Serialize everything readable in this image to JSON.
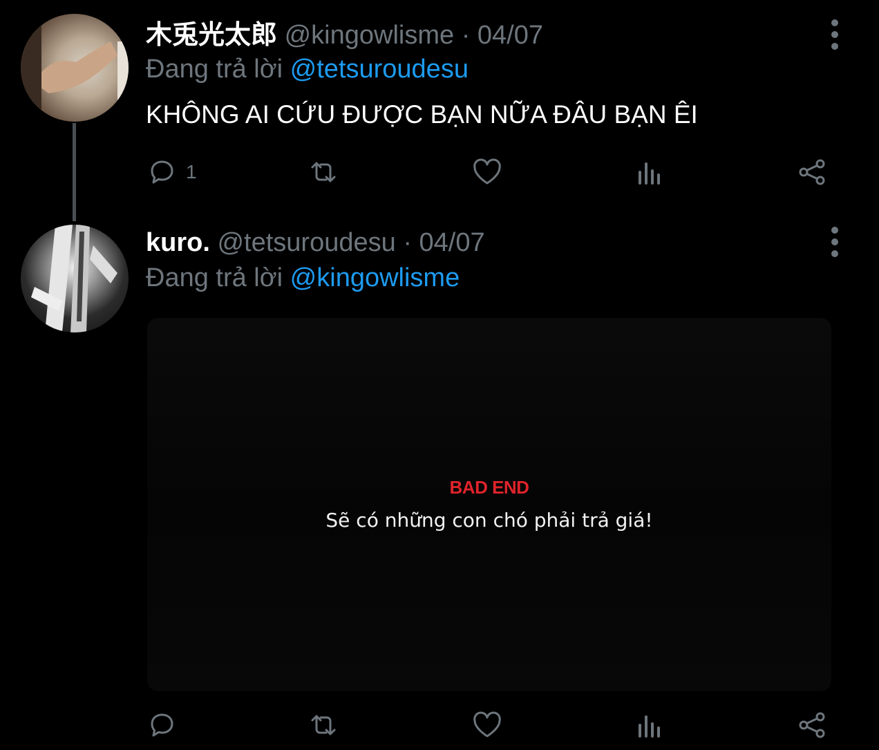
{
  "tweets": [
    {
      "author_name": "木兎光太郎",
      "author_handle": "@kingowlisme",
      "separator": "·",
      "date": "04/07",
      "replying_prefix": "Đang trả lời",
      "replying_to": "@tetsuroudesu",
      "text": "KHÔNG AI CỨU ĐƯỢC BẠN NỮA ĐÂU BẠN ÊI",
      "reply_count": "1",
      "avatar_icon": "avatar-flexing-arm"
    },
    {
      "author_name": "kuro.",
      "author_handle": "@tetsuroudesu",
      "separator": "·",
      "date": "04/07",
      "replying_prefix": "Đang trả lời",
      "replying_to": "@kingowlisme",
      "media": {
        "title": "BAD END",
        "caption": "Sẽ có những con chó phải trả giá!"
      },
      "reply_count": "",
      "avatar_icon": "avatar-striped-scarf"
    }
  ],
  "icons": {
    "reply": "reply-icon",
    "retweet": "retweet-icon",
    "like": "like-icon",
    "analytics": "analytics-icon",
    "share": "share-icon",
    "more": "more-options-icon"
  },
  "colors": {
    "background": "#000000",
    "muted": "#6e767d",
    "link": "#1d9bf0",
    "bad_end": "#e0232b"
  }
}
